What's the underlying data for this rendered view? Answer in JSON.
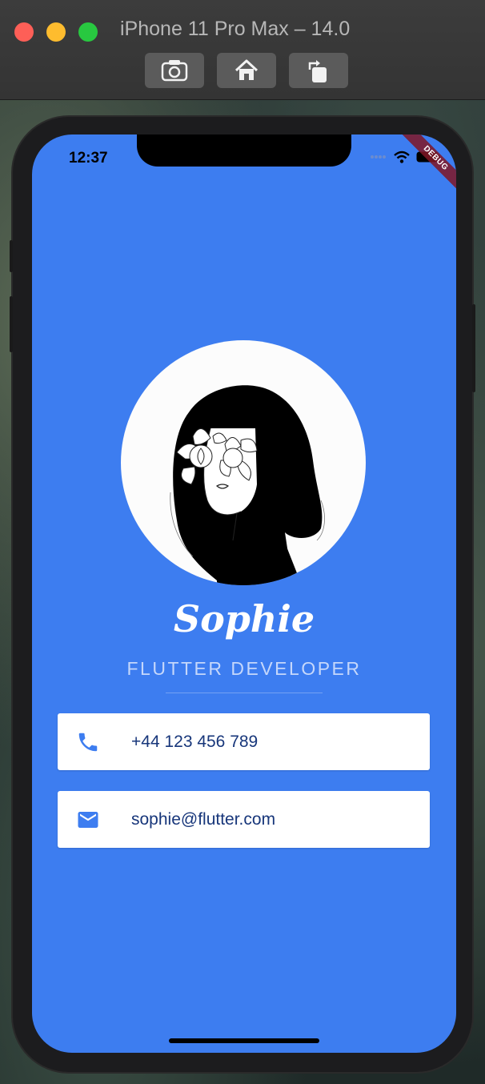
{
  "simulator": {
    "title": "iPhone 11 Pro Max – 14.0",
    "buttons": {
      "screenshot": "camera-icon",
      "home": "home-icon",
      "rotate": "rotate-icon"
    }
  },
  "status_bar": {
    "time": "12:37",
    "debug_label": "DEBUG"
  },
  "profile": {
    "name": "Sophie",
    "title": "FLUTTER DEVELOPER",
    "avatar_icon": "woman-portrait-illustration"
  },
  "contacts": {
    "phone": {
      "icon": "phone-icon",
      "value": "+44 123 456 789"
    },
    "email": {
      "icon": "mail-icon",
      "value": "sophie@flutter.com"
    }
  },
  "colors": {
    "background": "#3d7df0",
    "card_text": "#17367a",
    "title_text": "#c5d7fb",
    "icon": "#3d7df0"
  }
}
